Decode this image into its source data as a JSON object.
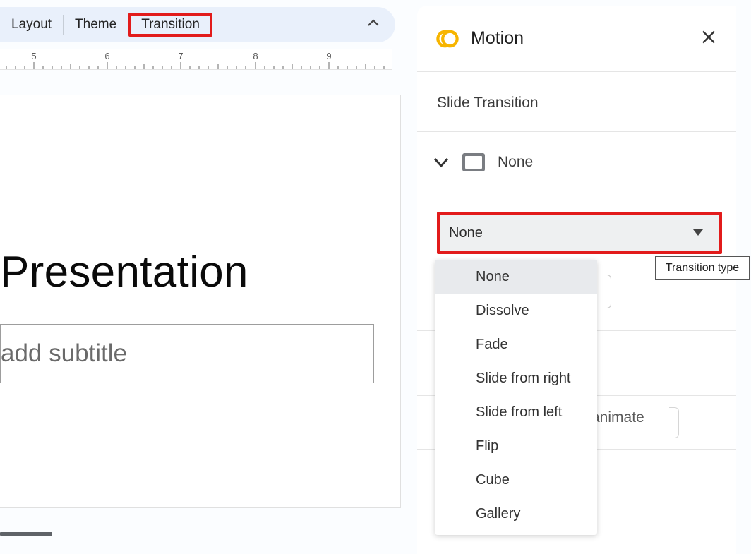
{
  "toolbar": {
    "layout": "Layout",
    "theme": "Theme",
    "transition": "Transition"
  },
  "ruler": {
    "marks": [
      5,
      6,
      7,
      8,
      9
    ]
  },
  "slide": {
    "title": "Presentation",
    "subtitle_placeholder": " add subtitle"
  },
  "motion": {
    "title": "Motion",
    "section": "Slide Transition",
    "current": "None",
    "dropdown_value": "None",
    "tooltip": "Transition type",
    "options": [
      "None",
      "Dissolve",
      "Fade",
      "Slide from right",
      "Slide from left",
      "Flip",
      "Cube",
      "Gallery"
    ],
    "animate_hint": " animate"
  },
  "colors": {
    "highlight": "#e21b1b",
    "toolbar_bg": "#e9f0fb",
    "brand": "#f7b500"
  }
}
